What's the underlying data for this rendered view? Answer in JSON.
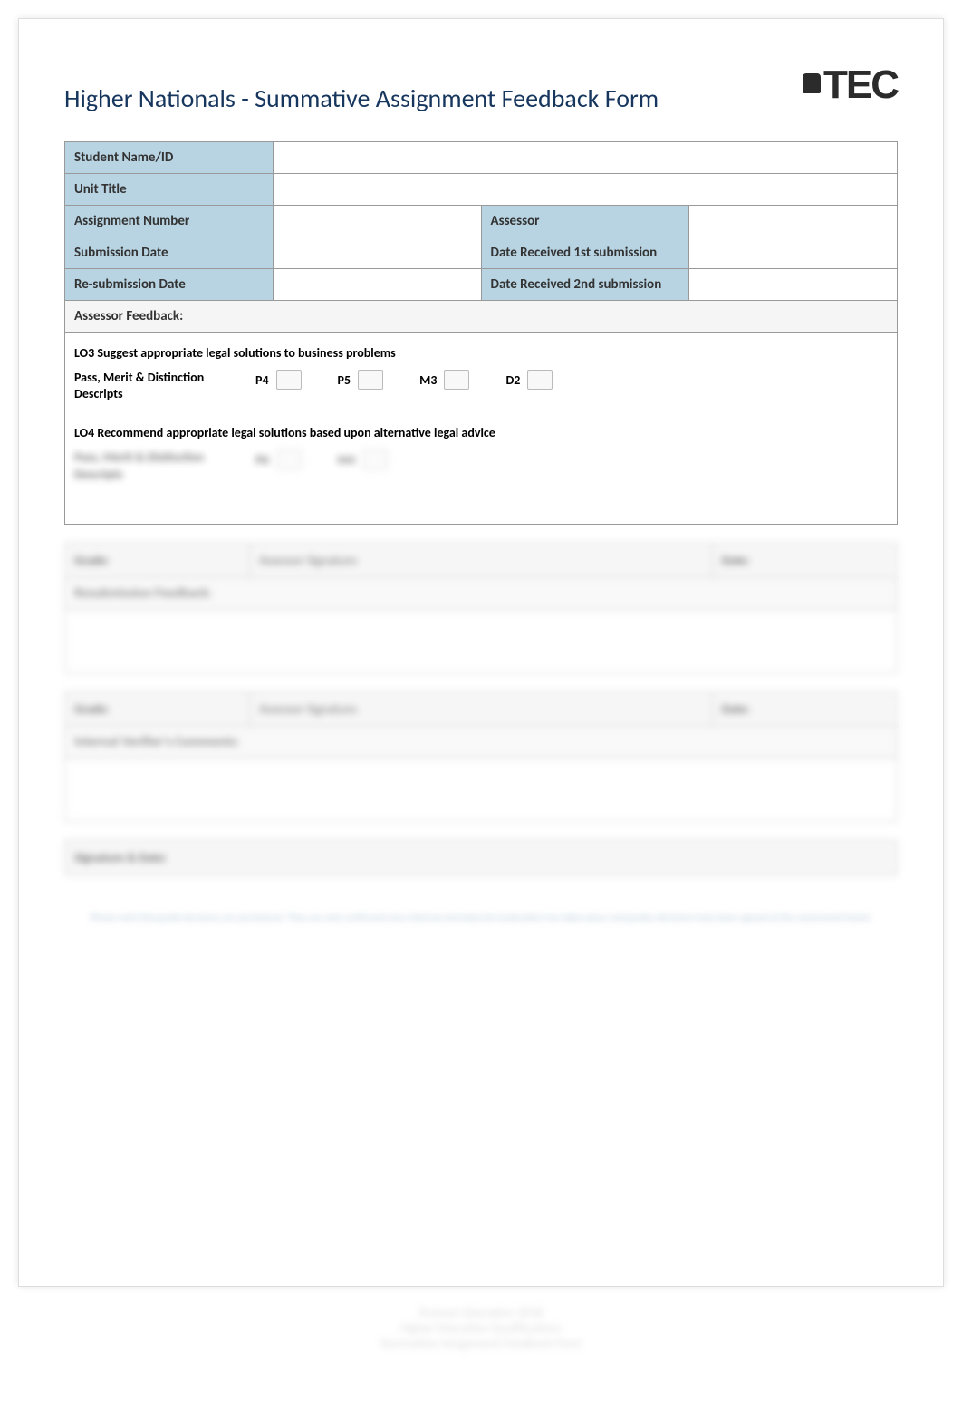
{
  "header": {
    "title": "Higher Nationals - Summative Assignment Feedback Form",
    "logo_text": "TEC"
  },
  "form": {
    "student_name_label": "Student Name/ID",
    "student_name_value": "",
    "unit_title_label": "Unit Title",
    "unit_title_value": "",
    "assignment_number_label": "Assignment Number",
    "assignment_number_value": "",
    "assessor_label": "Assessor",
    "assessor_value": "",
    "submission_date_label": "Submission Date",
    "submission_date_value": "",
    "date_received_1_label": "Date Received 1st submission",
    "date_received_1_value": "",
    "resubmission_date_label": "Re-submission Date",
    "resubmission_date_value": "",
    "date_received_2_label": "Date Received 2nd submission",
    "date_received_2_value": ""
  },
  "feedback": {
    "header": "Assessor  Feedback:",
    "lo3_tag": "LO3",
    "lo3_text": " Suggest appropriate legal solutions to business problems",
    "lo4_tag": "LO4",
    "lo4_text": " Recommend appropriate legal solutions based upon alternative legal advice",
    "grade_label": "Pass, Merit & Distinction Descripts",
    "grades_lo3": [
      "P4",
      "P5",
      "M3",
      "D2"
    ],
    "grades_lo4": [
      "P6",
      "M4"
    ]
  },
  "sig": {
    "grade_label": "Grade:",
    "assessor_sig_label": "Assessor Signature:",
    "date_label": "Date:",
    "resub_feedback_label": "Resubmission Feedback:",
    "iv_comments_label": "Internal Verifier's Comments:",
    "sig_date_label": "Signature & Date:"
  },
  "footer": {
    "note": "Please note that grade decisions are provisional. They are only confirmed once internal and external moderation has taken place and grades decisions have been agreed at the assessment board.",
    "caption_line1": "Pearson Education 2018",
    "caption_line2": "Higher Education Qualifications",
    "caption_line3": "Summative Assignment Feedback Form"
  }
}
